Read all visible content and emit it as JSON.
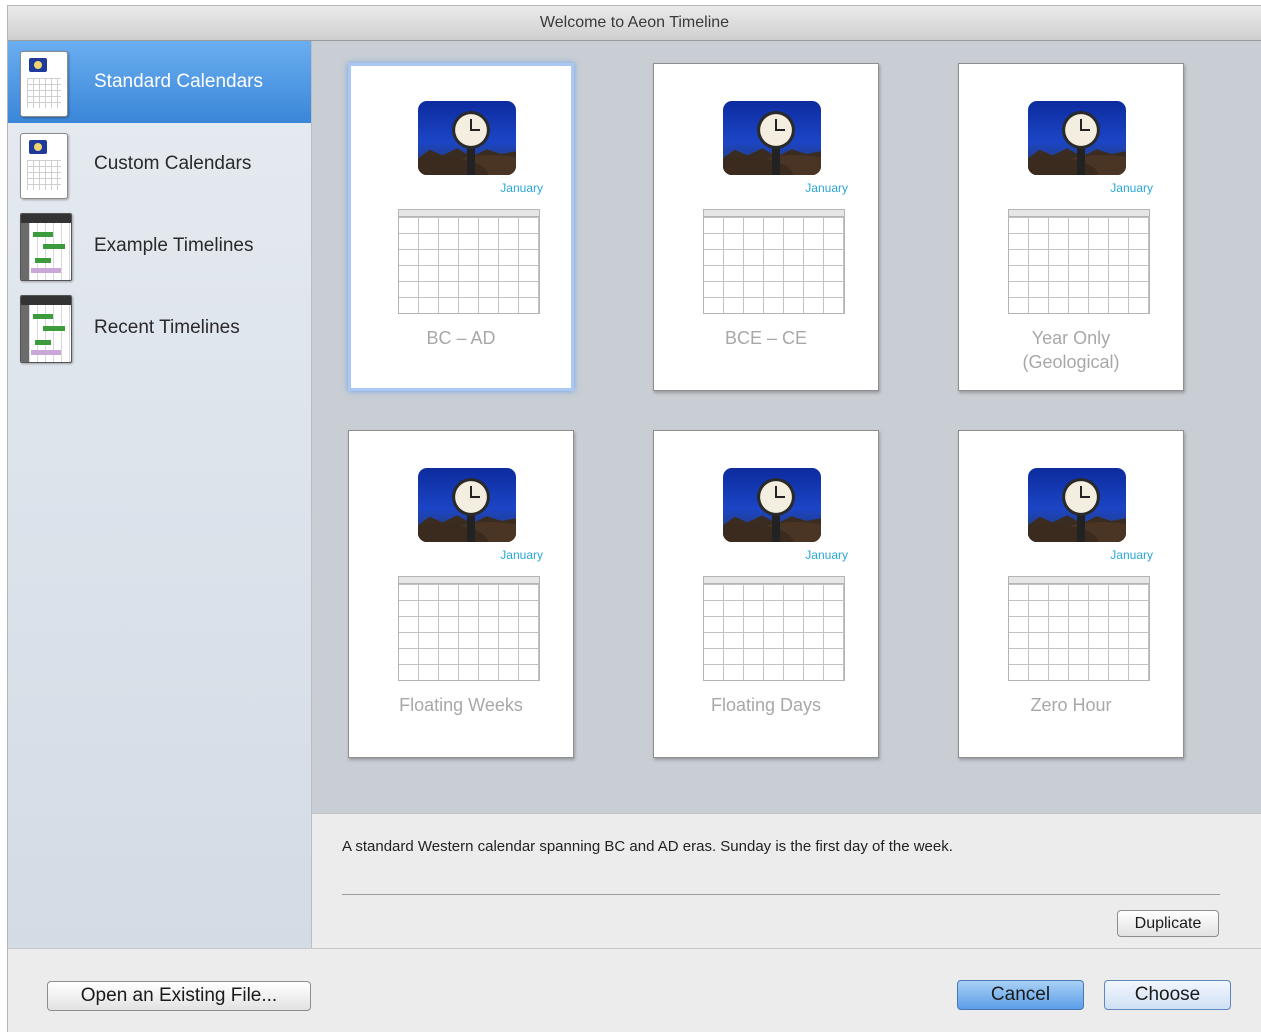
{
  "window": {
    "title": "Welcome to Aeon Timeline"
  },
  "sidebar": {
    "items": [
      {
        "label": "Standard Calendars",
        "icon": "calendar-document-icon",
        "selected": true
      },
      {
        "label": "Custom Calendars",
        "icon": "calendar-document-icon",
        "selected": false
      },
      {
        "label": "Example Timelines",
        "icon": "timeline-document-icon",
        "selected": false
      },
      {
        "label": "Recent Timelines",
        "icon": "timeline-document-icon",
        "selected": false
      }
    ]
  },
  "templates": [
    {
      "name": "BC – AD",
      "month": "January",
      "selected": true
    },
    {
      "name": "BCE – CE",
      "month": "January",
      "selected": false
    },
    {
      "name": "Year Only\n(Geological)",
      "month": "January",
      "selected": false
    },
    {
      "name": "Floating Weeks",
      "month": "January",
      "selected": false
    },
    {
      "name": "Floating Days",
      "month": "January",
      "selected": false
    },
    {
      "name": "Zero Hour",
      "month": "January",
      "selected": false
    }
  ],
  "description": {
    "text": "A standard Western calendar spanning BC and AD eras. Sunday is the first day of the week.",
    "duplicate_label": "Duplicate"
  },
  "footer": {
    "open_label": "Open an Existing File...",
    "cancel_label": "Cancel",
    "choose_label": "Choose"
  },
  "colors": {
    "selection": "#3a86d8",
    "month_accent": "#29a6d8"
  }
}
